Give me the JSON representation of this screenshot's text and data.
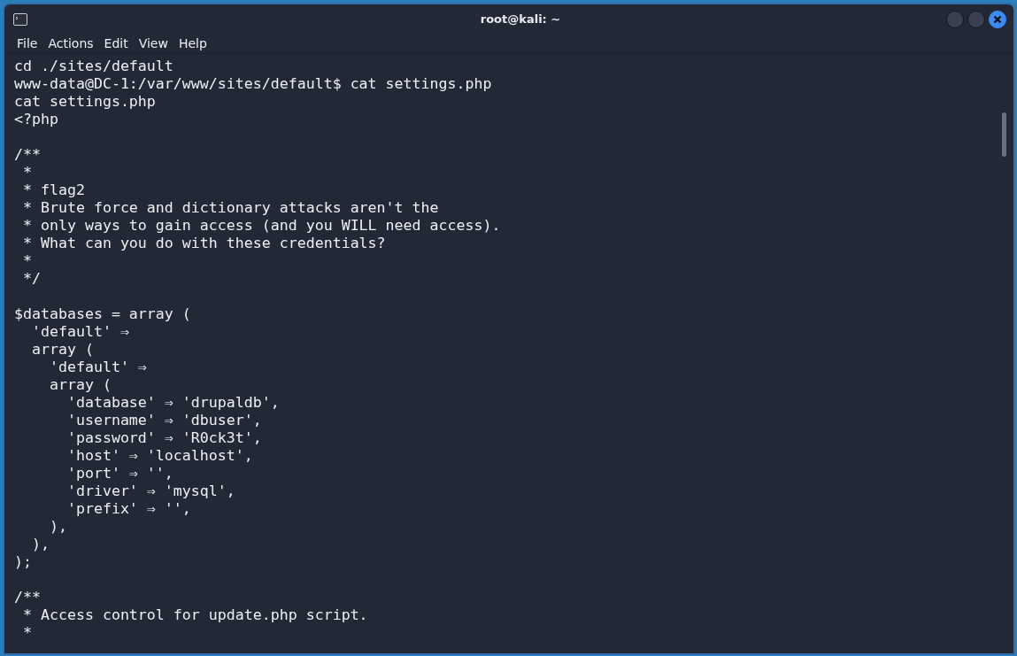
{
  "window": {
    "title": "root@kali: ~"
  },
  "menu": [
    "File",
    "Actions",
    "Edit",
    "View",
    "Help"
  ],
  "terminal": {
    "blocks": [
      {
        "lines": [
          "cd ./sites/default",
          "www-data@DC-1:/var/www/sites/default$ cat settings.php",
          "cat settings.php",
          "<?php"
        ]
      },
      {
        "lines": [
          "/**",
          " *",
          " * flag2",
          " * Brute force and dictionary attacks aren't the",
          " * only ways to gain access (and you WILL need access).",
          " * What can you do with these credentials?",
          " *",
          " */"
        ]
      },
      {
        "lines": [
          "$databases = array (",
          "  'default' ⇒",
          "  array (",
          "    'default' ⇒",
          "    array (",
          "      'database' ⇒ 'drupaldb',",
          "      'username' ⇒ 'dbuser',",
          "      'password' ⇒ 'R0ck3t',",
          "      'host' ⇒ 'localhost',",
          "      'port' ⇒ '',",
          "      'driver' ⇒ 'mysql',",
          "      'prefix' ⇒ '',",
          "    ),",
          "  ),",
          ");"
        ]
      },
      {
        "lines": [
          "/**",
          " * Access control for update.php script.",
          " *"
        ]
      }
    ]
  }
}
